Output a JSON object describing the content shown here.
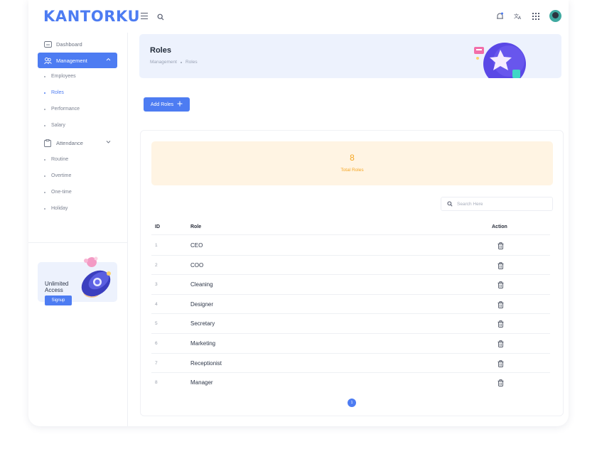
{
  "app": {
    "logo": "KANTORKU"
  },
  "header": {
    "icons": [
      "menu-icon",
      "search-icon",
      "notification-icon",
      "translate-icon",
      "apps-grid-icon",
      "user-avatar"
    ]
  },
  "sidebar": {
    "items": [
      {
        "label": "Dashboard",
        "icon": "dashboard-icon"
      },
      {
        "label": "Management",
        "icon": "management-icon",
        "expanded": true,
        "active": true
      },
      {
        "label": "Employees"
      },
      {
        "label": "Roles",
        "active": true
      },
      {
        "label": "Performance"
      },
      {
        "label": "Salary"
      },
      {
        "label": "Attendance",
        "icon": "clipboard-icon",
        "expanded": false
      },
      {
        "label": "Routine"
      },
      {
        "label": "Overtime"
      },
      {
        "label": "One-time"
      },
      {
        "label": "Holiday"
      }
    ],
    "promo": {
      "text": "Unlimited Access",
      "button": "Signup"
    }
  },
  "page": {
    "title": "Roles",
    "breadcrumb": [
      "Management",
      "Roles"
    ],
    "add_button": "Add Roles",
    "stat": {
      "value": "8",
      "label": "Total Roles"
    },
    "search": {
      "placeholder": "Search Here",
      "value": ""
    },
    "table": {
      "columns": [
        "ID",
        "Role",
        "Action"
      ],
      "rows": [
        {
          "id": "1",
          "role": "CEO"
        },
        {
          "id": "2",
          "role": "COO"
        },
        {
          "id": "3",
          "role": "Cleaning"
        },
        {
          "id": "4",
          "role": "Designer"
        },
        {
          "id": "5",
          "role": "Secretary"
        },
        {
          "id": "6",
          "role": "Marketing"
        },
        {
          "id": "7",
          "role": "Receptionist"
        },
        {
          "id": "8",
          "role": "Manager"
        }
      ]
    },
    "pagination": {
      "current": "1"
    }
  },
  "colors": {
    "accent": "#4d7cf2",
    "banner": "#edf2fd",
    "stat_bg": "#fff4e3",
    "stat_text": "#f5a623"
  }
}
